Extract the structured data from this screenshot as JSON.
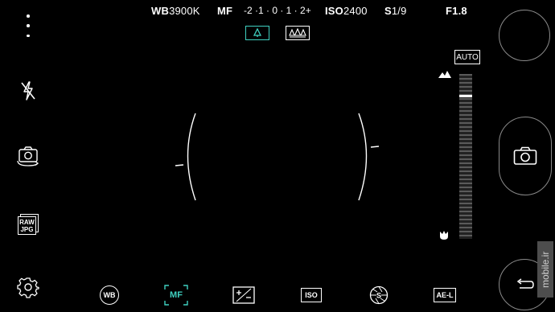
{
  "status": {
    "wb_label": "WB",
    "wb_value": "3900K",
    "mf_label": "MF",
    "ev_scale": "-2 ·1 · 0 · 1 · 2+",
    "iso_label": "ISO",
    "iso_value": "2400",
    "shutter_label": "S",
    "shutter_value": "1/9",
    "aperture": "F1.8"
  },
  "right_panel": {
    "auto_label": "AUTO"
  },
  "toolbar": {
    "wb_label": "WB",
    "mf_label": "MF",
    "iso_label": "ISO",
    "ael_label": "AE-L"
  },
  "side": {
    "raw_label": "RAW",
    "jpg_label": "JPG"
  },
  "watermark": "mobile.ir",
  "colors": {
    "accent": "#3fd0c0",
    "background": "#000000"
  }
}
